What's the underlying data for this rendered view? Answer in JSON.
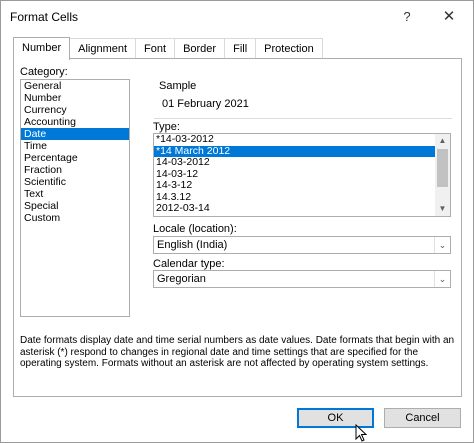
{
  "window": {
    "title": "Format Cells",
    "help_label": "?",
    "close_label": "✕"
  },
  "tabs": [
    {
      "label": "Number",
      "active": true
    },
    {
      "label": "Alignment",
      "active": false
    },
    {
      "label": "Font",
      "active": false
    },
    {
      "label": "Border",
      "active": false
    },
    {
      "label": "Fill",
      "active": false
    },
    {
      "label": "Protection",
      "active": false
    }
  ],
  "category": {
    "label": "Category:",
    "items": [
      "General",
      "Number",
      "Currency",
      "Accounting",
      "Date",
      "Time",
      "Percentage",
      "Fraction",
      "Scientific",
      "Text",
      "Special",
      "Custom"
    ],
    "selected": "Date"
  },
  "sample": {
    "label": "Sample",
    "value": "01 February 2021"
  },
  "type": {
    "label": "Type:",
    "items": [
      "*14-03-2012",
      "*14 March 2012",
      "14-03-2012",
      "14-03-12",
      "14-3-12",
      "14.3.12",
      "2012-03-14"
    ],
    "selected": "*14 March 2012"
  },
  "locale": {
    "label": "Locale (location):",
    "value": "English (India)"
  },
  "calendar": {
    "label": "Calendar type:",
    "value": "Gregorian"
  },
  "description": "Date formats display date and time serial numbers as date values.  Date formats that begin with an asterisk (*) respond to changes in regional date and time settings that are specified for the operating system. Formats without an asterisk are not affected by operating system settings.",
  "buttons": {
    "ok": "OK",
    "cancel": "Cancel"
  },
  "icons": {
    "scroll_up": "▲",
    "scroll_down": "▼",
    "dropdown": "⌄"
  },
  "colors": {
    "selection": "#0078d7",
    "default_button_border": "#0078d7"
  }
}
